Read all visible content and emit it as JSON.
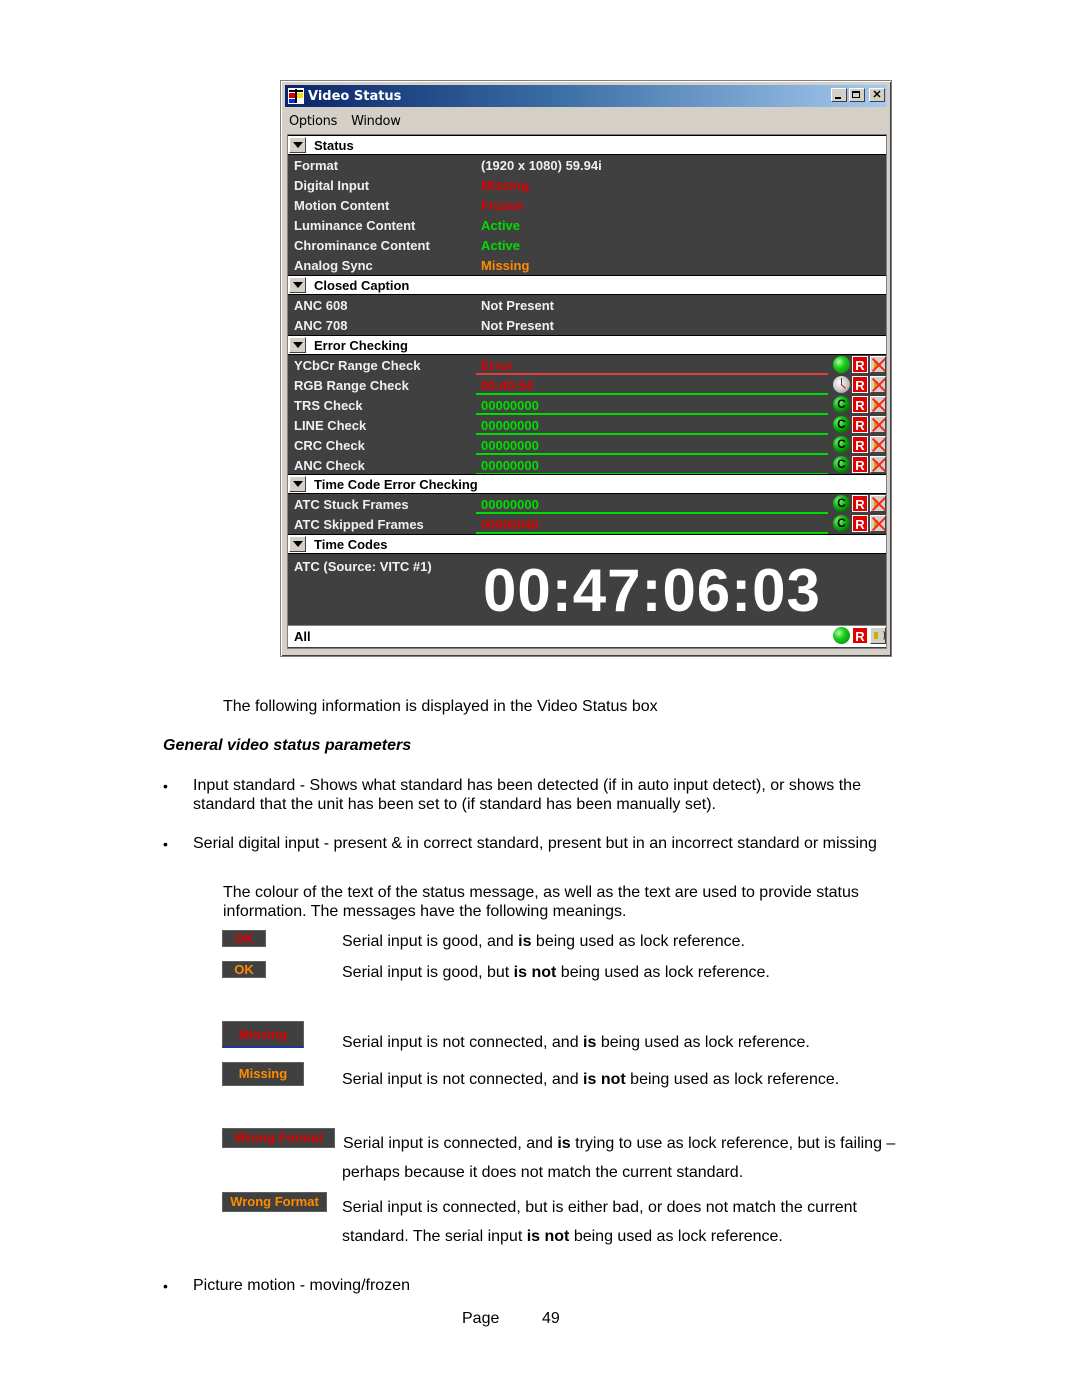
{
  "window": {
    "title": "Video Status",
    "menu": [
      "Options",
      "Window"
    ],
    "sections": {
      "status": {
        "title": "Status",
        "rows": [
          {
            "label": "Format",
            "value": "(1920 x 1080) 59.94i",
            "color": "#f0f0f0"
          },
          {
            "label": "Digital Input",
            "value": "Missing",
            "color": "#e00000"
          },
          {
            "label": "Motion Content",
            "value": "Frozen",
            "color": "#e00000"
          },
          {
            "label": "Luminance Content",
            "value": "Active",
            "color": "#00dd00"
          },
          {
            "label": "Chrominance Content",
            "value": "Active",
            "color": "#00dd00"
          },
          {
            "label": "Analog Sync",
            "value": "Missing",
            "color": "#ff8c00"
          }
        ]
      },
      "closed_caption": {
        "title": "Closed Caption",
        "rows": [
          {
            "label": "ANC 608",
            "value": "Not Present"
          },
          {
            "label": "ANC 708",
            "value": "Not Present"
          }
        ]
      },
      "error_checking": {
        "title": "Error Checking",
        "rows": [
          {
            "label": "YCbCr Range Check",
            "value": "Error",
            "color": "#e00000",
            "bar": "#e04040",
            "indicator": "led-green"
          },
          {
            "label": "RGB Range Check",
            "value": "00:40:54",
            "color": "#e00000",
            "bar": "#00dd00",
            "indicator": "clock"
          },
          {
            "label": "TRS Check",
            "value": "00000000",
            "color": "#00dd00",
            "bar": "#00dd00",
            "indicator": "led-c"
          },
          {
            "label": "LINE Check",
            "value": "00000000",
            "color": "#00dd00",
            "bar": "#00dd00",
            "indicator": "led-c"
          },
          {
            "label": "CRC Check",
            "value": "00000000",
            "color": "#00dd00",
            "bar": "#00dd00",
            "indicator": "led-c"
          },
          {
            "label": "ANC Check",
            "value": "00000000",
            "color": "#00dd00",
            "bar": "#00dd00",
            "indicator": "led-c"
          }
        ]
      },
      "time_code_error_checking": {
        "title": "Time Code Error Checking",
        "rows": [
          {
            "label": "ATC Stuck Frames",
            "value": "00000000",
            "color": "#00dd00",
            "bar": "#00dd00",
            "indicator": "led-c"
          },
          {
            "label": "ATC Skipped Frames",
            "value": "00000040",
            "color": "#e00000",
            "bar": "#00dd00",
            "indicator": "led-c"
          }
        ]
      },
      "time_codes": {
        "title": "Time Codes",
        "source_label": "ATC (Source: VITC #1)",
        "timecode": "00:47:06:03"
      }
    },
    "footer": {
      "label": "All"
    },
    "reset_label": "R",
    "c_label": "C"
  },
  "doc": {
    "intro": "The following information is displayed in the Video Status box",
    "heading": "General video status parameters",
    "bullet1": "Input standard - Shows what standard has been detected (if in auto input detect), or shows the standard that the unit has been set to (if standard has been manually set).",
    "bullet2": "Serial digital input - present & in correct standard, present but in an incorrect standard or missing",
    "colour_para": "The colour of the text of the status message, as well as the text are used to provide status information.  The messages have the following meanings.",
    "legend": [
      {
        "badge": "OK",
        "color": "#e00000",
        "pre": "Serial input is good, and ",
        "bold": "is",
        "post": " being used as lock reference."
      },
      {
        "badge": "OK",
        "color": "#ff8c00",
        "pre": "Serial input is good, but ",
        "bold": "is not",
        "post": " being used as lock reference."
      },
      {
        "badge": "Missing",
        "color": "#e00000",
        "pre": "Serial input is not connected, and ",
        "bold": "is",
        "post": " being used as lock reference."
      },
      {
        "badge": "Missing",
        "color": "#ff8c00",
        "pre": "Serial input is not connected, and ",
        "bold": "is not",
        "post": " being used as lock reference."
      },
      {
        "badge": "Wrong Format",
        "color": "#e00000",
        "pre": "Serial input is connected, and ",
        "bold": "is",
        "post": " trying to use as lock reference, but is failing –",
        "line2": "perhaps because it does not match the current standard."
      },
      {
        "badge": "Wrong Format",
        "color": "#ff8c00",
        "pre": "Serial input is connected, but is either bad, or does not match the current",
        "bold": "",
        "post": "",
        "line2_pre": "standard.  The serial input ",
        "line2_bold": "is not",
        "line2_post": " being used as lock reference."
      }
    ],
    "bullet3": "Picture motion - moving/frozen",
    "page_label": "Page",
    "page_number": "49",
    "bullet_glyph": "•"
  }
}
